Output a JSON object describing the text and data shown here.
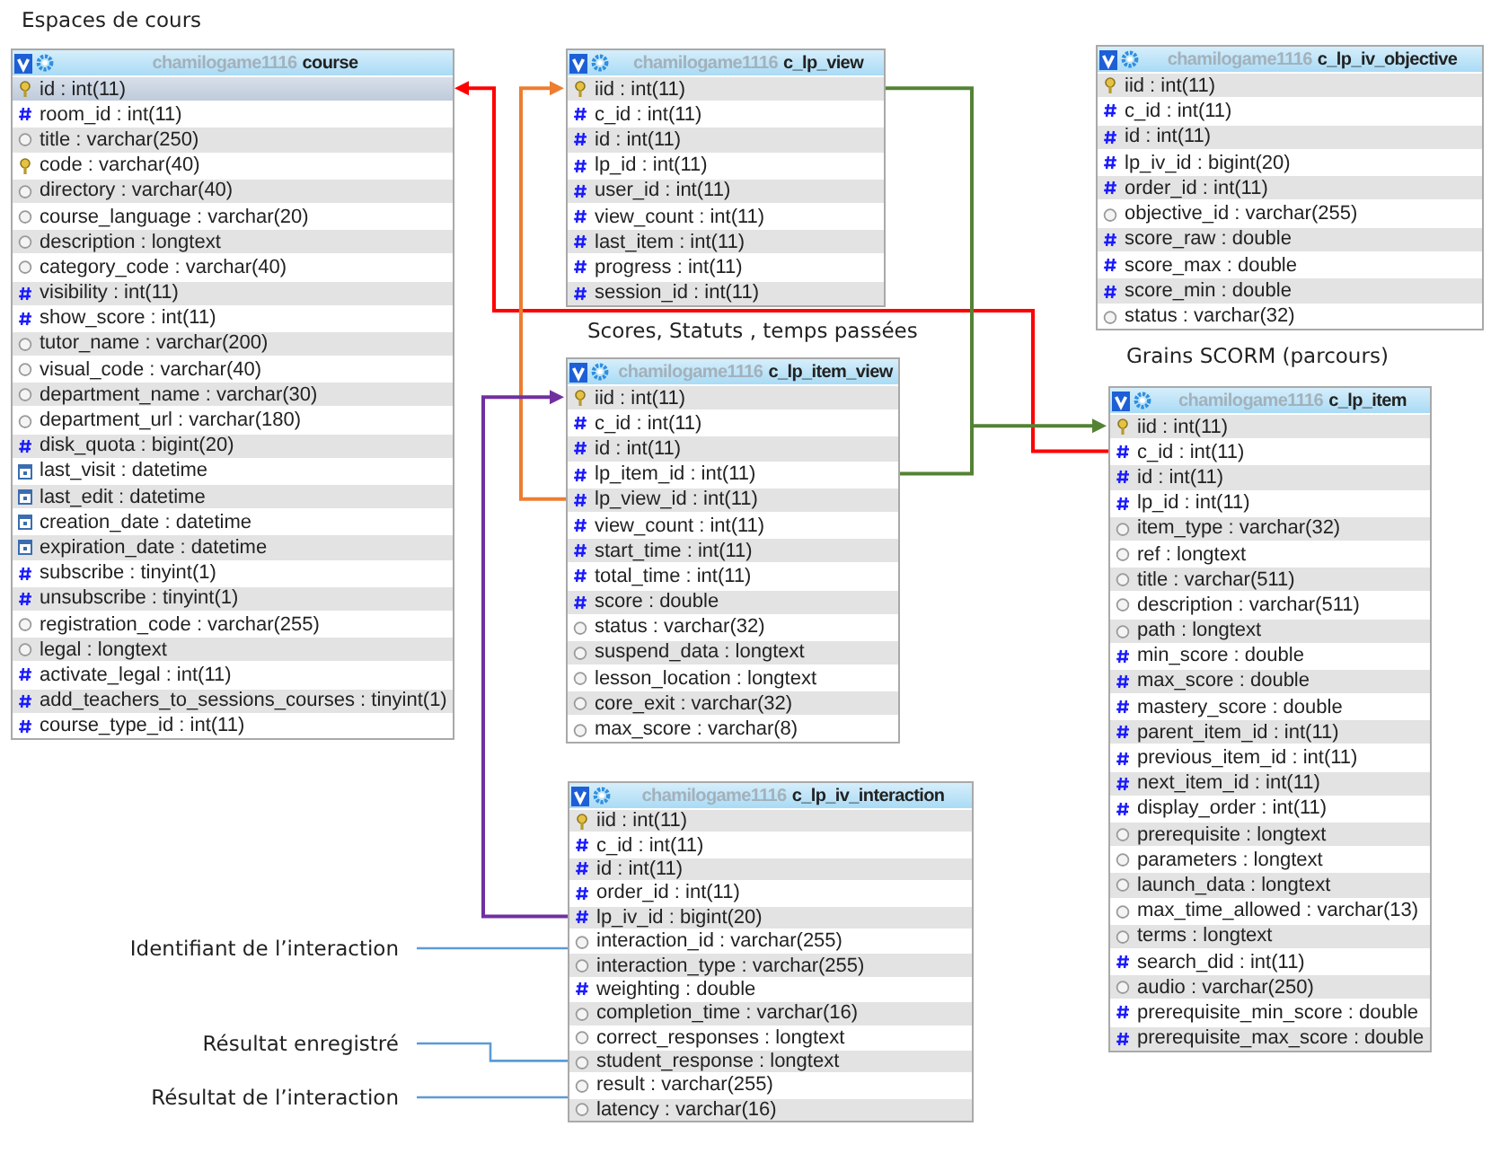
{
  "captions": [
    "Espaces de cours",
    "Scores, Statuts , temps passées",
    "Grains SCORM (parcours)"
  ],
  "tables": [
    {
      "schema": "chamilogame1116",
      "name": "course",
      "rows": [
        {
          "kind": "key",
          "text": "id : int(11)",
          "selected": true
        },
        {
          "kind": "number",
          "text": "room_id : int(11)",
          "selected": false
        },
        {
          "kind": "text",
          "text": "title : varchar(250)",
          "selected": false
        },
        {
          "kind": "key",
          "text": "code : varchar(40)",
          "selected": false
        },
        {
          "kind": "text",
          "text": "directory : varchar(40)",
          "selected": false
        },
        {
          "kind": "text",
          "text": "course_language : varchar(20)",
          "selected": false
        },
        {
          "kind": "text",
          "text": "description : longtext",
          "selected": false
        },
        {
          "kind": "text",
          "text": "category_code : varchar(40)",
          "selected": false
        },
        {
          "kind": "number",
          "text": "visibility : int(11)",
          "selected": false
        },
        {
          "kind": "number",
          "text": "show_score : int(11)",
          "selected": false
        },
        {
          "kind": "text",
          "text": "tutor_name : varchar(200)",
          "selected": false
        },
        {
          "kind": "text",
          "text": "visual_code : varchar(40)",
          "selected": false
        },
        {
          "kind": "text",
          "text": "department_name : varchar(30)",
          "selected": false
        },
        {
          "kind": "text",
          "text": "department_url : varchar(180)",
          "selected": false
        },
        {
          "kind": "number",
          "text": "disk_quota : bigint(20)",
          "selected": false
        },
        {
          "kind": "date",
          "text": "last_visit : datetime",
          "selected": false
        },
        {
          "kind": "date",
          "text": "last_edit : datetime",
          "selected": false
        },
        {
          "kind": "date",
          "text": "creation_date : datetime",
          "selected": false
        },
        {
          "kind": "date",
          "text": "expiration_date : datetime",
          "selected": false
        },
        {
          "kind": "number",
          "text": "subscribe : tinyint(1)",
          "selected": false
        },
        {
          "kind": "number",
          "text": "unsubscribe : tinyint(1)",
          "selected": false
        },
        {
          "kind": "text",
          "text": "registration_code : varchar(255)",
          "selected": false
        },
        {
          "kind": "text",
          "text": "legal : longtext",
          "selected": false
        },
        {
          "kind": "number",
          "text": "activate_legal : int(11)",
          "selected": false
        },
        {
          "kind": "number",
          "text": "add_teachers_to_sessions_courses : tinyint(1)",
          "selected": false
        },
        {
          "kind": "number",
          "text": "course_type_id : int(11)",
          "selected": false
        }
      ]
    },
    {
      "schema": "chamilogame1116",
      "name": "c_lp_view",
      "rows": [
        {
          "kind": "key",
          "text": "iid : int(11)"
        },
        {
          "kind": "number",
          "text": "c_id : int(11)"
        },
        {
          "kind": "number",
          "text": "id : int(11)"
        },
        {
          "kind": "number",
          "text": "lp_id : int(11)"
        },
        {
          "kind": "number",
          "text": "user_id : int(11)"
        },
        {
          "kind": "number",
          "text": "view_count : int(11)"
        },
        {
          "kind": "number",
          "text": "last_item : int(11)"
        },
        {
          "kind": "number",
          "text": "progress : int(11)"
        },
        {
          "kind": "number",
          "text": "session_id : int(11)"
        }
      ]
    },
    {
      "schema": "chamilogame1116",
      "name": "c_lp_iv_objective",
      "rows": [
        {
          "kind": "key",
          "text": "iid : int(11)"
        },
        {
          "kind": "number",
          "text": "c_id : int(11)"
        },
        {
          "kind": "number",
          "text": "id : int(11)"
        },
        {
          "kind": "number",
          "text": "lp_iv_id : bigint(20)"
        },
        {
          "kind": "number",
          "text": "order_id : int(11)"
        },
        {
          "kind": "text",
          "text": "objective_id : varchar(255)"
        },
        {
          "kind": "number",
          "text": "score_raw : double"
        },
        {
          "kind": "number",
          "text": "score_max : double"
        },
        {
          "kind": "number",
          "text": "score_min : double"
        },
        {
          "kind": "text",
          "text": "status : varchar(32)"
        }
      ]
    },
    {
      "schema": "chamilogame1116",
      "name": "c_lp_item_view",
      "rows": [
        {
          "kind": "key",
          "text": "iid : int(11)"
        },
        {
          "kind": "number",
          "text": "c_id : int(11)"
        },
        {
          "kind": "number",
          "text": "id : int(11)"
        },
        {
          "kind": "number",
          "text": "lp_item_id : int(11)"
        },
        {
          "kind": "number",
          "text": "lp_view_id : int(11)"
        },
        {
          "kind": "number",
          "text": "view_count : int(11)"
        },
        {
          "kind": "number",
          "text": "start_time : int(11)"
        },
        {
          "kind": "number",
          "text": "total_time : int(11)"
        },
        {
          "kind": "number",
          "text": "score : double"
        },
        {
          "kind": "text",
          "text": "status : varchar(32)"
        },
        {
          "kind": "text",
          "text": "suspend_data : longtext"
        },
        {
          "kind": "text",
          "text": "lesson_location : longtext"
        },
        {
          "kind": "text",
          "text": "core_exit : varchar(32)"
        },
        {
          "kind": "text",
          "text": "max_score : varchar(8)"
        }
      ]
    },
    {
      "schema": "chamilogame1116",
      "name": "c_lp_item",
      "rows": [
        {
          "kind": "key",
          "text": "iid : int(11)"
        },
        {
          "kind": "number",
          "text": "c_id : int(11)"
        },
        {
          "kind": "number",
          "text": "id : int(11)"
        },
        {
          "kind": "number",
          "text": "lp_id : int(11)"
        },
        {
          "kind": "text",
          "text": "item_type : varchar(32)"
        },
        {
          "kind": "text",
          "text": "ref : longtext"
        },
        {
          "kind": "text",
          "text": "title : varchar(511)"
        },
        {
          "kind": "text",
          "text": "description : varchar(511)"
        },
        {
          "kind": "text",
          "text": "path : longtext"
        },
        {
          "kind": "number",
          "text": "min_score : double"
        },
        {
          "kind": "number",
          "text": "max_score : double"
        },
        {
          "kind": "number",
          "text": "mastery_score : double"
        },
        {
          "kind": "number",
          "text": "parent_item_id : int(11)"
        },
        {
          "kind": "number",
          "text": "previous_item_id : int(11)"
        },
        {
          "kind": "number",
          "text": "next_item_id : int(11)"
        },
        {
          "kind": "number",
          "text": "display_order : int(11)"
        },
        {
          "kind": "text",
          "text": "prerequisite : longtext"
        },
        {
          "kind": "text",
          "text": "parameters : longtext"
        },
        {
          "kind": "text",
          "text": "launch_data : longtext"
        },
        {
          "kind": "text",
          "text": "max_time_allowed : varchar(13)"
        },
        {
          "kind": "text",
          "text": "terms : longtext"
        },
        {
          "kind": "number",
          "text": "search_did : int(11)"
        },
        {
          "kind": "text",
          "text": "audio : varchar(250)"
        },
        {
          "kind": "number",
          "text": "prerequisite_min_score : double"
        },
        {
          "kind": "number",
          "text": "prerequisite_max_score : double"
        }
      ]
    },
    {
      "schema": "chamilogame1116",
      "name": "c_lp_iv_interaction",
      "rows": [
        {
          "kind": "key",
          "text": "iid : int(11)"
        },
        {
          "kind": "number",
          "text": "c_id : int(11)"
        },
        {
          "kind": "number",
          "text": "id : int(11)"
        },
        {
          "kind": "number",
          "text": "order_id : int(11)"
        },
        {
          "kind": "number",
          "text": "lp_iv_id : bigint(20)"
        },
        {
          "kind": "text",
          "text": "interaction_id : varchar(255)"
        },
        {
          "kind": "text",
          "text": "interaction_type : varchar(255)"
        },
        {
          "kind": "number",
          "text": "weighting : double"
        },
        {
          "kind": "text",
          "text": "completion_time : varchar(16)"
        },
        {
          "kind": "text",
          "text": "correct_responses : longtext"
        },
        {
          "kind": "text",
          "text": "student_response : longtext"
        },
        {
          "kind": "text",
          "text": "result : varchar(255)"
        },
        {
          "kind": "text",
          "text": "latency : varchar(16)"
        }
      ]
    }
  ],
  "relations": [
    {
      "color": "#ff0000"
    },
    {
      "color": "#ed7d31"
    },
    {
      "color": "#548235"
    },
    {
      "color": "#7030a0"
    }
  ],
  "annotations": [
    "Identifiant de l’interaction",
    "Résultat enregistré",
    "Résultat de l’interaction"
  ]
}
